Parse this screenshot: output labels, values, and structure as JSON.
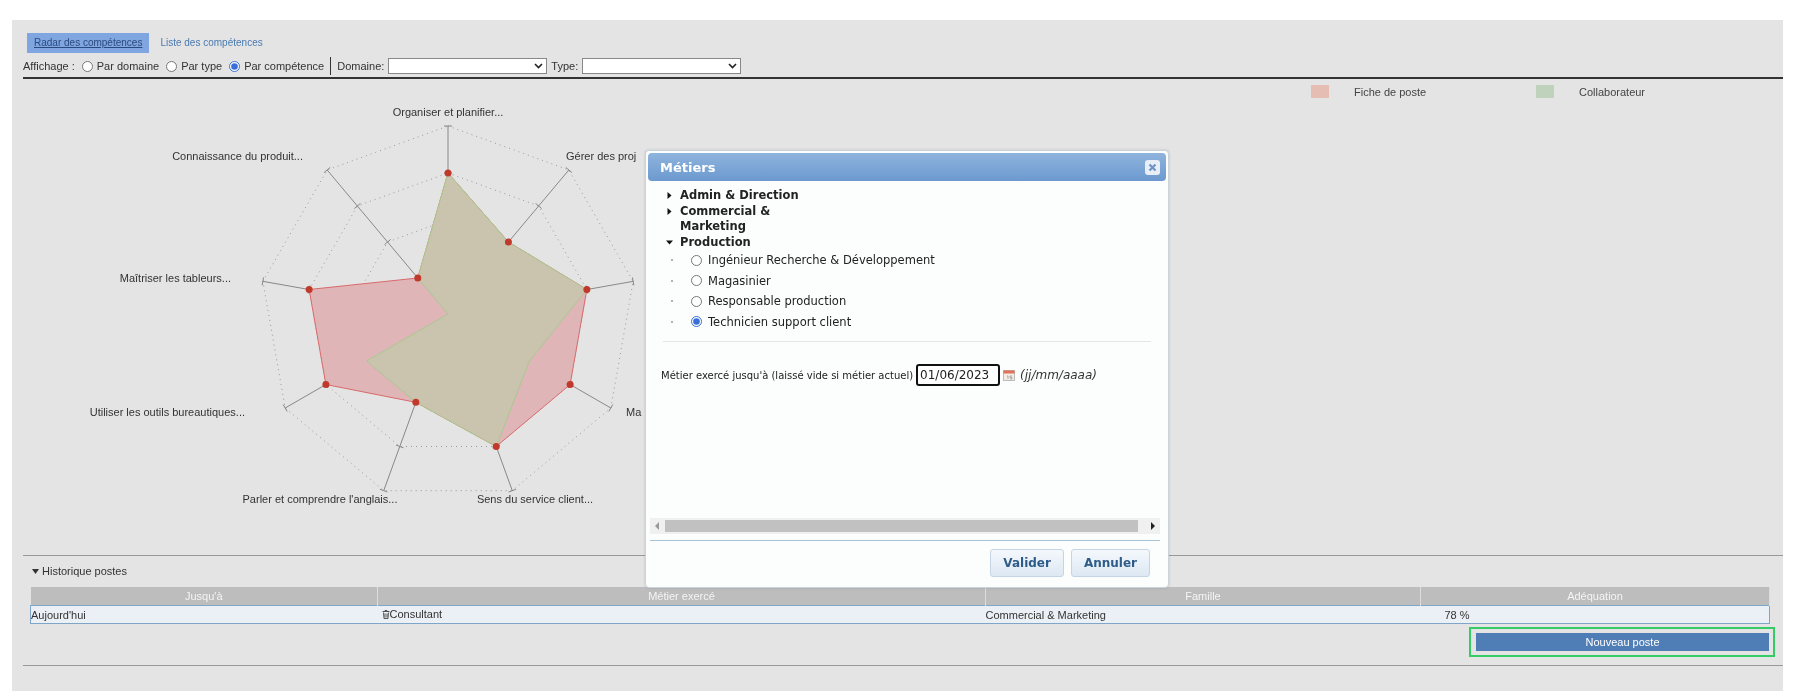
{
  "tabs": [
    {
      "label": "Radar des compétences",
      "selected": true
    },
    {
      "label": "Liste des compétences",
      "selected": false
    }
  ],
  "display": {
    "label": "Affichage :",
    "options": [
      {
        "label": "Par domaine",
        "selected": false
      },
      {
        "label": "Par type",
        "selected": false
      },
      {
        "label": "Par compétence",
        "selected": true
      }
    ],
    "domain_label": "Domaine:",
    "type_label": "Type:"
  },
  "legend": [
    {
      "label": "Fiche de poste",
      "color": "#e6bdb2"
    },
    {
      "label": "Collaborateur",
      "color": "#bfd3bc"
    }
  ],
  "radar": {
    "axis_labels": [
      "Organiser et planifier...",
      "Connaissance du produit...",
      "Gérer des proj",
      "Maîtriser les tableurs...",
      "Utiliser les outils bureautiques...",
      "Ma",
      "Parler et comprendre l'anglais...",
      "Sens du service client..."
    ]
  },
  "history": {
    "title": "Historique postes",
    "expanded": true,
    "columns": [
      "Jusqu'à",
      "Métier exercé",
      "Famille",
      "Adéquation"
    ],
    "rows": [
      {
        "until": "Aujourd'hui",
        "job": "Consultant",
        "family": "Commercial & Marketing",
        "match": "78 %"
      }
    ],
    "new_button": "Nouveau poste"
  },
  "dialog": {
    "title": "Métiers",
    "tree": [
      {
        "label": "Admin & Direction",
        "expanded": false
      },
      {
        "label": "Commercial & Marketing",
        "expanded": false
      },
      {
        "label": "Production",
        "expanded": true,
        "children": [
          {
            "label": "Ingénieur Recherche & Développement",
            "selected": false
          },
          {
            "label": "Magasinier",
            "selected": false
          },
          {
            "label": "Responsable production",
            "selected": false
          },
          {
            "label": "Technicien support client",
            "selected": true
          }
        ]
      }
    ],
    "date_label": "Métier exercé jusqu'à (laissé vide si métier actuel)",
    "date_value": "01/06/2023",
    "date_hint": "(jj/mm/aaaa)",
    "buttons": [
      "Valider",
      "Annuler"
    ]
  }
}
